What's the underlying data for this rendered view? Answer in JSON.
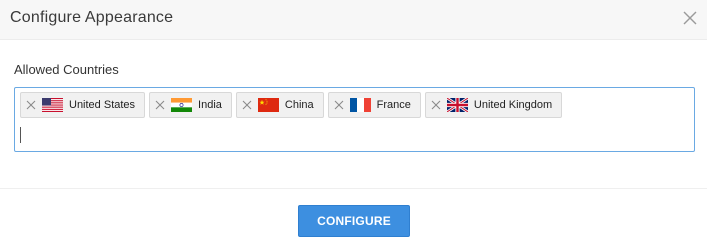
{
  "dialog": {
    "title": "Configure Appearance",
    "close_icon": "close-icon"
  },
  "field": {
    "label": "Allowed Countries",
    "input_value": "",
    "border_color": "#6aa9e3"
  },
  "tags": [
    {
      "label": "United States",
      "flag": "us-flag-icon",
      "remove_icon": "close-icon"
    },
    {
      "label": "India",
      "flag": "india-flag-icon",
      "remove_icon": "close-icon"
    },
    {
      "label": "China",
      "flag": "china-flag-icon",
      "remove_icon": "close-icon"
    },
    {
      "label": "France",
      "flag": "france-flag-icon",
      "remove_icon": "close-icon"
    },
    {
      "label": "United Kingdom",
      "flag": "uk-flag-icon",
      "remove_icon": "close-icon"
    }
  ],
  "footer": {
    "configure_label": "CONFIGURE",
    "button_color": "#3d8fe0"
  }
}
